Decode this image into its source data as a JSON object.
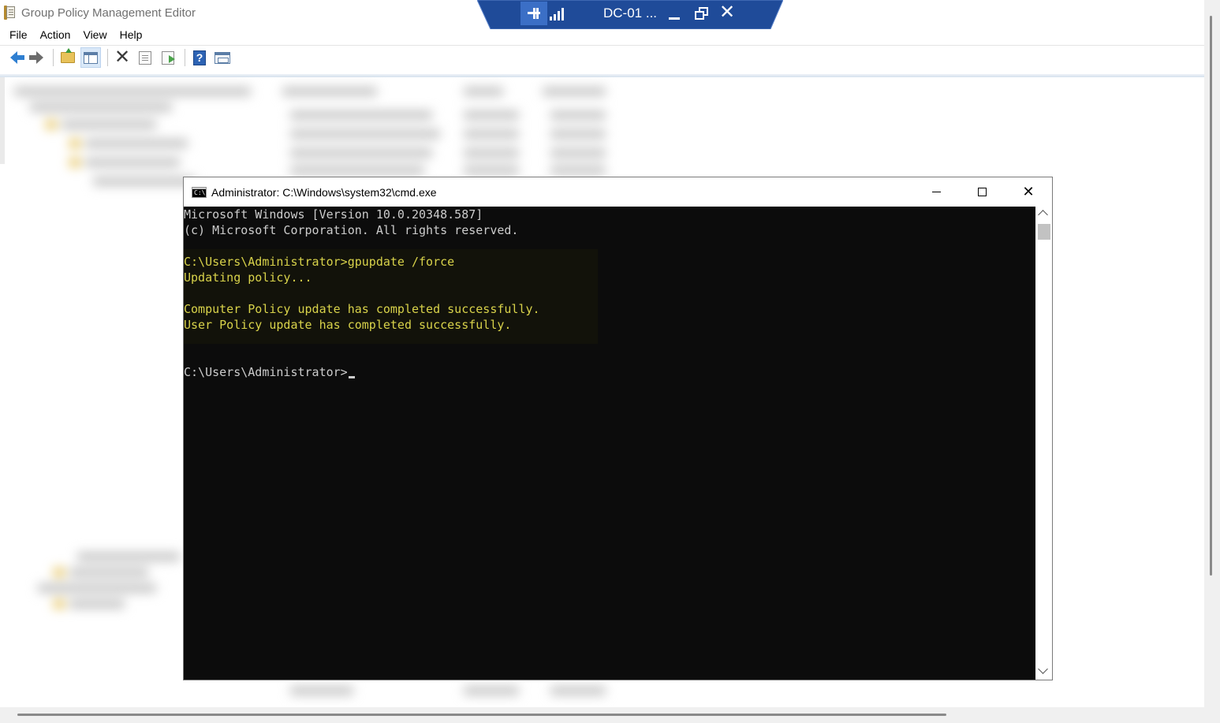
{
  "gpme": {
    "title": "Group Policy Management Editor",
    "menu": [
      "File",
      "Action",
      "View",
      "Help"
    ],
    "toolbar": {
      "help_glyph": "?",
      "delete_glyph": "✕"
    }
  },
  "rdp_bar": {
    "name": "DC-01 ...",
    "close_glyph": "✕"
  },
  "cmd": {
    "title": "Administrator: C:\\Windows\\system32\\cmd.exe",
    "icon_text": "C:\\",
    "close_glyph": "✕",
    "lines": [
      "Microsoft Windows [Version 10.0.20348.587]",
      "(c) Microsoft Corporation. All rights reserved.",
      "",
      "C:\\Users\\Administrator>gpupdate /force",
      "Updating policy...",
      "",
      "Computer Policy update has completed successfully.",
      "User Policy update has completed successfully.",
      "",
      "",
      "C:\\Users\\Administrator>"
    ]
  },
  "colors": {
    "console_bg": "#0c0c0c",
    "console_text": "#cccccc",
    "console_highlight_text": "#d8d24a",
    "rdp_bar_bg": "#1f4b99"
  }
}
